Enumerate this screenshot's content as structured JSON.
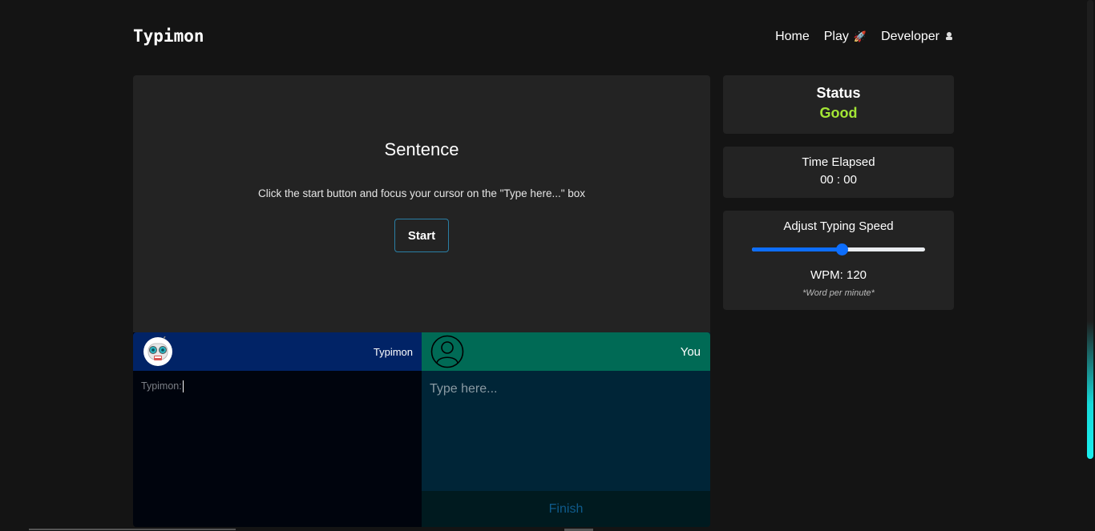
{
  "brand": "Typimon",
  "nav": {
    "home": "Home",
    "play": "Play",
    "play_icon": "rocket-icon",
    "developer": "Developer",
    "developer_icon": "developer-icon"
  },
  "game": {
    "title": "Sentence",
    "instruction": "Click the start button and focus your cursor on the \"Type here...\" box",
    "start_label": "Start"
  },
  "bot": {
    "name": "Typimon",
    "avatar_icon": "robot-icon",
    "text": "Typimon:"
  },
  "user": {
    "name": "You",
    "avatar_icon": "user-icon",
    "input_placeholder": "Type here...",
    "input_value": "",
    "finish_label": "Finish"
  },
  "status": {
    "label": "Status",
    "value": "Good",
    "value_color": "#a3e635"
  },
  "time": {
    "label": "Time Elapsed",
    "value": "00 : 00"
  },
  "speed": {
    "label": "Adjust Typing Speed",
    "slider_fraction": 0.52,
    "wpm_text": "WPM: 120",
    "note": "*Word per minute*"
  },
  "colors": {
    "accent": "#0d6efd",
    "bot_header": "#012366",
    "user_header": "#006a55",
    "status_good": "#a3e635"
  }
}
